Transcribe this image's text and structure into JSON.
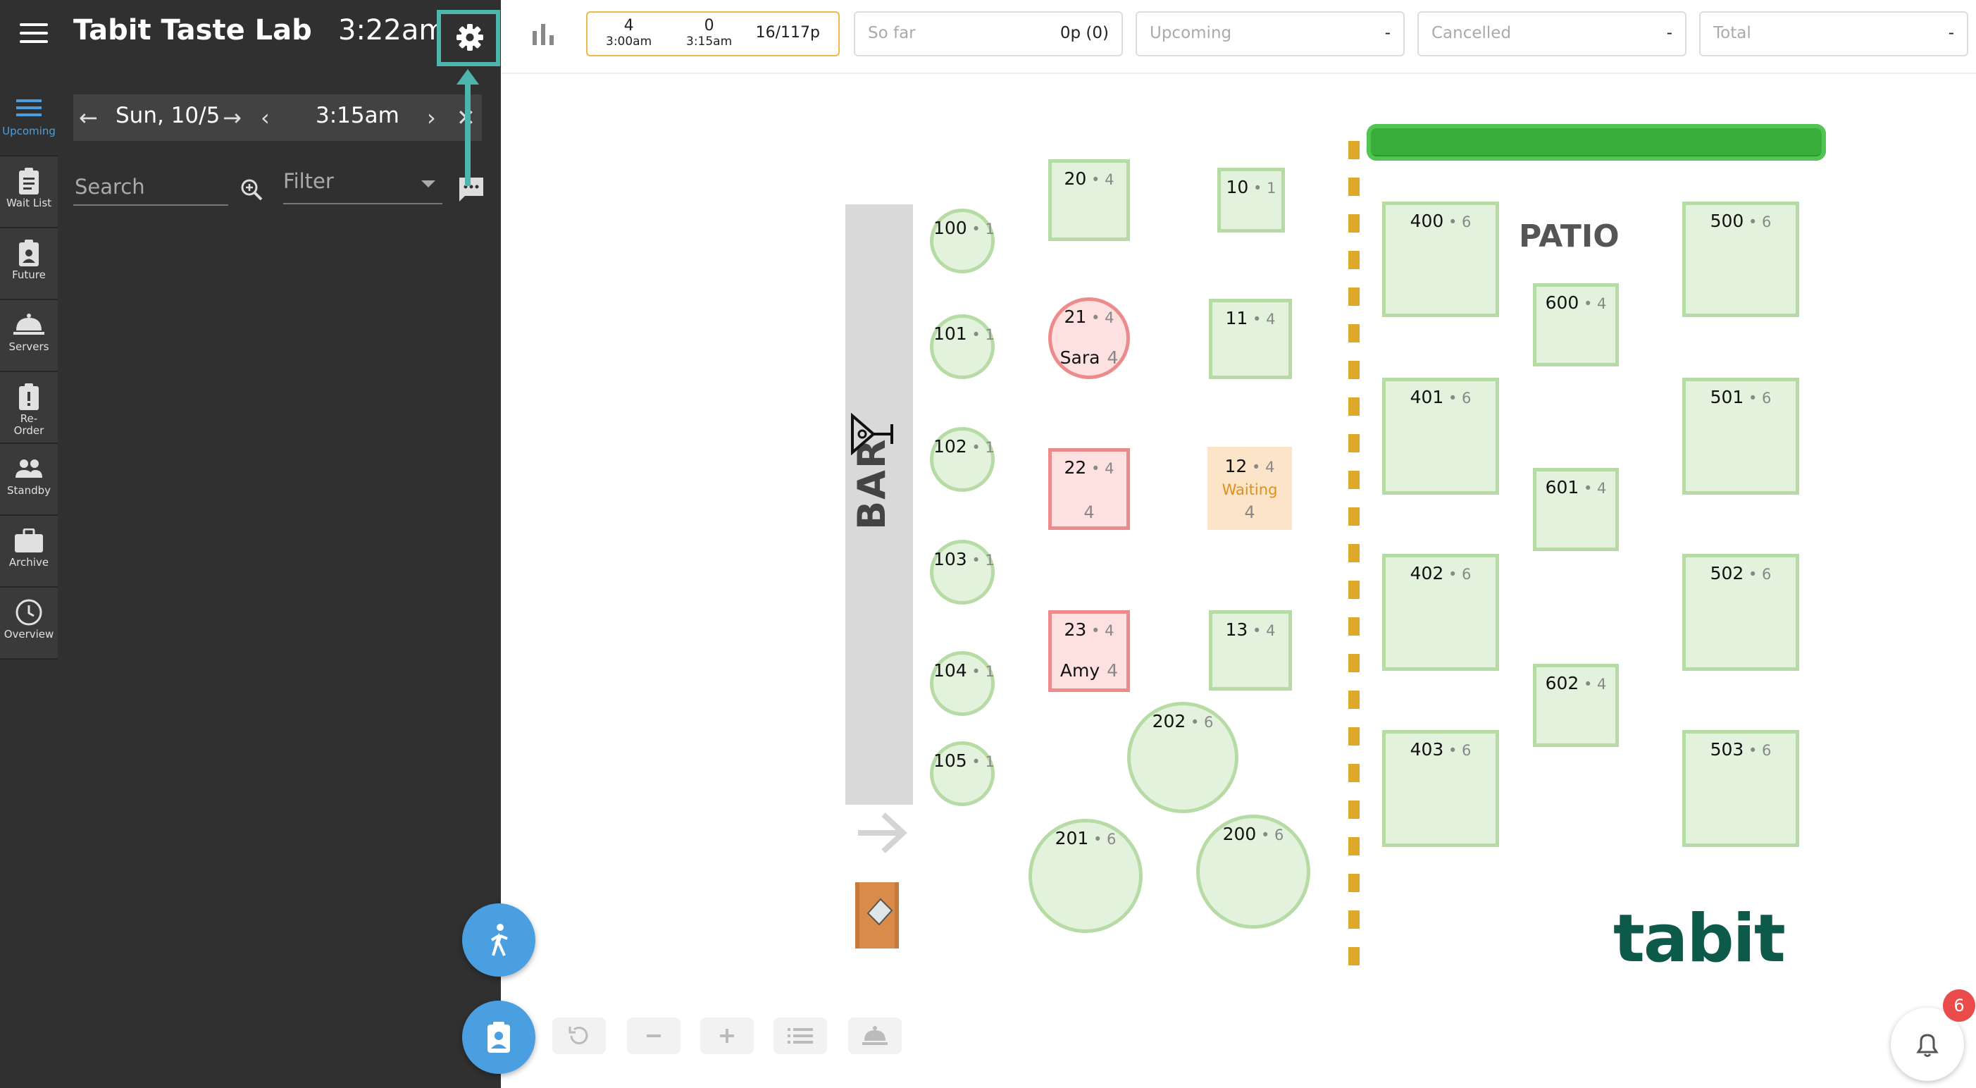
{
  "header": {
    "title": "Tabit Taste Lab",
    "clock": "3:22am"
  },
  "nav": [
    {
      "label": "Upcoming",
      "icon": "list-icon",
      "active": true
    },
    {
      "label": "Wait List",
      "icon": "clipboard-icon"
    },
    {
      "label": "Future",
      "icon": "clipboard-person-icon"
    },
    {
      "label": "Servers",
      "icon": "cloche-icon"
    },
    {
      "label": "Re-\nOrder",
      "icon": "alert-clipboard-icon"
    },
    {
      "label": "Standby",
      "icon": "people-icon"
    },
    {
      "label": "Archive",
      "icon": "briefcase-icon"
    },
    {
      "label": "Overview",
      "icon": "clock-icon"
    }
  ],
  "datebar": {
    "date": "Sun, 10/5",
    "time": "3:15am"
  },
  "search": {
    "placeholder": "Search"
  },
  "filter": {
    "label": "Filter"
  },
  "stats": {
    "timeline": [
      {
        "count": "4",
        "time": "3:00am"
      },
      {
        "count": "0",
        "time": "3:15am"
      }
    ],
    "timeline_total": "16/117p",
    "so_far": {
      "label": "So far",
      "value": "0p (0)"
    },
    "upcoming": {
      "label": "Upcoming",
      "value": "-"
    },
    "cancelled": {
      "label": "Cancelled",
      "value": "-"
    },
    "total": {
      "label": "Total",
      "value": "-"
    }
  },
  "floor": {
    "bar_label": "BAR",
    "patio_label": "PATIO",
    "brand": "tabit",
    "tables": [
      {
        "id": "t100",
        "num": "100",
        "cap": "1",
        "shape": "round",
        "status": "free"
      },
      {
        "id": "t101",
        "num": "101",
        "cap": "1",
        "shape": "round",
        "status": "free"
      },
      {
        "id": "t102",
        "num": "102",
        "cap": "1",
        "shape": "round",
        "status": "free"
      },
      {
        "id": "t103",
        "num": "103",
        "cap": "1",
        "shape": "round",
        "status": "free"
      },
      {
        "id": "t104",
        "num": "104",
        "cap": "1",
        "shape": "round",
        "status": "free"
      },
      {
        "id": "t105",
        "num": "105",
        "cap": "1",
        "shape": "round",
        "status": "free"
      },
      {
        "id": "t20",
        "num": "20",
        "cap": "4",
        "shape": "square",
        "status": "free"
      },
      {
        "id": "t21",
        "num": "21",
        "cap": "4",
        "shape": "round",
        "status": "seated",
        "guest": "Sara",
        "guest_count": "4"
      },
      {
        "id": "t22",
        "num": "22",
        "cap": "4",
        "shape": "square",
        "status": "seated",
        "sub": "4"
      },
      {
        "id": "t23",
        "num": "23",
        "cap": "4",
        "shape": "square",
        "status": "seated",
        "guest": "Amy",
        "guest_count": "4"
      },
      {
        "id": "t10",
        "num": "10",
        "cap": "1",
        "shape": "square",
        "status": "free"
      },
      {
        "id": "t11",
        "num": "11",
        "cap": "4",
        "shape": "square",
        "status": "free"
      },
      {
        "id": "t12",
        "num": "12",
        "cap": "4",
        "shape": "square",
        "status": "waiting",
        "status_text": "Waiting",
        "sub": "4"
      },
      {
        "id": "t13",
        "num": "13",
        "cap": "4",
        "shape": "square",
        "status": "free"
      },
      {
        "id": "t202",
        "num": "202",
        "cap": "6",
        "shape": "round",
        "status": "free"
      },
      {
        "id": "t201",
        "num": "201",
        "cap": "6",
        "shape": "round",
        "status": "free"
      },
      {
        "id": "t200",
        "num": "200",
        "cap": "6",
        "shape": "round",
        "status": "free"
      },
      {
        "id": "t400",
        "num": "400",
        "cap": "6",
        "shape": "square",
        "status": "free"
      },
      {
        "id": "t401",
        "num": "401",
        "cap": "6",
        "shape": "square",
        "status": "free"
      },
      {
        "id": "t402",
        "num": "402",
        "cap": "6",
        "shape": "square",
        "status": "free"
      },
      {
        "id": "t403",
        "num": "403",
        "cap": "6",
        "shape": "square",
        "status": "free"
      },
      {
        "id": "t600",
        "num": "600",
        "cap": "4",
        "shape": "square",
        "status": "free"
      },
      {
        "id": "t601",
        "num": "601",
        "cap": "4",
        "shape": "square",
        "status": "free"
      },
      {
        "id": "t602",
        "num": "602",
        "cap": "4",
        "shape": "square",
        "status": "free"
      },
      {
        "id": "t500",
        "num": "500",
        "cap": "6",
        "shape": "square",
        "status": "free"
      },
      {
        "id": "t501",
        "num": "501",
        "cap": "6",
        "shape": "square",
        "status": "free"
      },
      {
        "id": "t502",
        "num": "502",
        "cap": "6",
        "shape": "square",
        "status": "free"
      },
      {
        "id": "t503",
        "num": "503",
        "cap": "6",
        "shape": "square",
        "status": "free"
      }
    ]
  },
  "notifications": {
    "count": "6"
  },
  "colors": {
    "accent": "#4a9fe0",
    "highlight": "#4db6ac",
    "seated": "#ec8b8b",
    "waiting": "#e0901a",
    "free": "#b6dba4"
  }
}
